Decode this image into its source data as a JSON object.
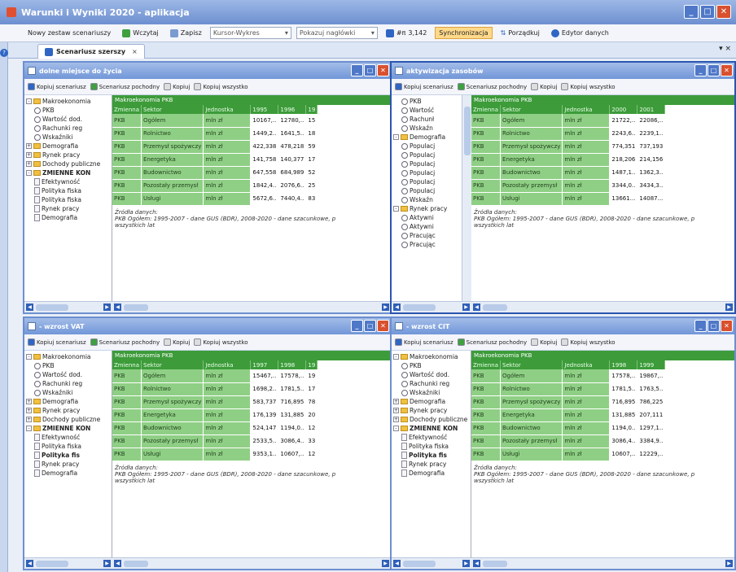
{
  "app": {
    "title": "Warunki i Wyniki 2020 - aplikacja"
  },
  "toolbar": {
    "new_scenario": "Nowy zestaw scenariuszy",
    "import": "Wczytaj",
    "save": "Zapisz",
    "combo1": "Kursor-Wykres",
    "combo2": "Pokazuj nagłówki",
    "value": "3,142",
    "sync": "Synchronizacja",
    "pozadkuj": "Porządkuj",
    "editor": "Edytor danych"
  },
  "doc_tab": {
    "label": "Scenariusz szerszy",
    "close": "×",
    "pin": "▾ ×"
  },
  "panel_tb": {
    "copy_scen": "Kopiuj scenariusz",
    "derived": "Scenariusz pochodny",
    "copy": "Kopiuj",
    "copy_all": "Kopiuj wszystko"
  },
  "grid": {
    "header": "Makroekonomia PKB",
    "cols": [
      "Zmienna",
      "Sektor",
      "Jednostka"
    ],
    "unit": "mln zł",
    "sectors": [
      "Ogółem",
      "Rolnictwo",
      "Przemysł spożywczy",
      "Energetyka",
      "Budownictwo",
      "Pozostały przemysł",
      "Usługi"
    ],
    "var": "PKB",
    "source_l1": "Źródła danych:",
    "source_l2": "PKB Ogółem: 1995-2007 - dane GUS (BDR), 2008-2020 - dane szacunkowe, p",
    "source_l3": "wszystkich lat"
  },
  "panels": [
    {
      "title": "dolne miejsce do życia",
      "years": [
        "1995",
        "1996",
        "19"
      ],
      "rows": [
        [
          "10167,..",
          "12780,..",
          "15"
        ],
        [
          "1449,2..",
          "1641,5..",
          "18"
        ],
        [
          "422,338",
          "478,218",
          "59"
        ],
        [
          "141,758",
          "140,377",
          "17"
        ],
        [
          "647,558",
          "684,989",
          "52"
        ],
        [
          "1842,4..",
          "2076,6..",
          "25"
        ],
        [
          "5672,6..",
          "7440,4..",
          "83"
        ]
      ]
    },
    {
      "title": "aktywizacja zasobów",
      "years": [
        "2000",
        "2001"
      ],
      "rows": [
        [
          "21722,..",
          "22086,.."
        ],
        [
          "2243,6..",
          "2239,1.."
        ],
        [
          "774,351",
          "737,193"
        ],
        [
          "218,206",
          "214,156"
        ],
        [
          "1487,1..",
          "1362,3.."
        ],
        [
          "3344,0..",
          "3434,3.."
        ],
        [
          "13661...",
          "14087..."
        ]
      ]
    },
    {
      "title": "- wzrost VAT",
      "years": [
        "1997",
        "1998",
        "19"
      ],
      "rows": [
        [
          "15467,..",
          "17578,..",
          "19"
        ],
        [
          "1698,2..",
          "1781,5..",
          "17"
        ],
        [
          "583,737",
          "716,895",
          "78"
        ],
        [
          "176,139",
          "131,885",
          "20"
        ],
        [
          "524,147",
          "1194,0..",
          "12"
        ],
        [
          "2533,5..",
          "3086,4..",
          "33"
        ],
        [
          "9353,1..",
          "10607,..",
          "12"
        ]
      ]
    },
    {
      "title": "- wzrost CIT",
      "years": [
        "1998",
        "1999"
      ],
      "rows": [
        [
          "17578,..",
          "19867,.."
        ],
        [
          "1781,5..",
          "1763,5.."
        ],
        [
          "716,895",
          "786,225"
        ],
        [
          "131,885",
          "207,111"
        ],
        [
          "1194,0..",
          "1297,1.."
        ],
        [
          "3086,4..",
          "3384,9.."
        ],
        [
          "10607,..",
          "12229,.."
        ]
      ]
    }
  ],
  "tree_a": [
    {
      "t": "Makroekonomia",
      "lvl": 0,
      "k": "fold",
      "e": "-"
    },
    {
      "t": "PKB",
      "lvl": 1,
      "k": "mag"
    },
    {
      "t": "Wartość dod.",
      "lvl": 1,
      "k": "mag"
    },
    {
      "t": "Rachunki reg",
      "lvl": 1,
      "k": "mag"
    },
    {
      "t": "Wskaźniki",
      "lvl": 1,
      "k": "mag"
    },
    {
      "t": "Demografia",
      "lvl": 0,
      "k": "fold",
      "e": "+"
    },
    {
      "t": "Rynek pracy",
      "lvl": 0,
      "k": "fold",
      "e": "+"
    },
    {
      "t": "Dochody publiczne",
      "lvl": 0,
      "k": "fold",
      "e": "+"
    },
    {
      "t": "ZMIENNE KON",
      "lvl": 0,
      "k": "fold",
      "e": "-",
      "b": true
    },
    {
      "t": "Efektywność",
      "lvl": 1,
      "k": "doc"
    },
    {
      "t": "Polityka fiska",
      "lvl": 1,
      "k": "doc"
    },
    {
      "t": "Polityka fiska",
      "lvl": 1,
      "k": "doc"
    },
    {
      "t": "Rynek pracy",
      "lvl": 1,
      "k": "doc"
    },
    {
      "t": "Demografia",
      "lvl": 1,
      "k": "doc"
    }
  ],
  "tree_b": [
    {
      "t": "PKB",
      "lvl": 1,
      "k": "mag"
    },
    {
      "t": "Wartość",
      "lvl": 1,
      "k": "mag"
    },
    {
      "t": "Rachunł",
      "lvl": 1,
      "k": "mag"
    },
    {
      "t": "Wskaźn",
      "lvl": 1,
      "k": "mag"
    },
    {
      "t": "Demografia",
      "lvl": 0,
      "k": "fold",
      "e": "-"
    },
    {
      "t": "Populacj",
      "lvl": 1,
      "k": "mag"
    },
    {
      "t": "Populacj",
      "lvl": 1,
      "k": "mag"
    },
    {
      "t": "Populacj",
      "lvl": 1,
      "k": "mag"
    },
    {
      "t": "Populacj",
      "lvl": 1,
      "k": "mag"
    },
    {
      "t": "Populacj",
      "lvl": 1,
      "k": "mag"
    },
    {
      "t": "Populacj",
      "lvl": 1,
      "k": "mag"
    },
    {
      "t": "Wskaźn",
      "lvl": 1,
      "k": "mag"
    },
    {
      "t": "Rynek pracy",
      "lvl": 0,
      "k": "fold",
      "e": "-"
    },
    {
      "t": "Aktywni",
      "lvl": 1,
      "k": "mag"
    },
    {
      "t": "Aktywni",
      "lvl": 1,
      "k": "mag"
    },
    {
      "t": "Pracując",
      "lvl": 1,
      "k": "mag"
    },
    {
      "t": "Pracując",
      "lvl": 1,
      "k": "mag"
    }
  ],
  "tree_c": [
    {
      "t": "Makroekonomia",
      "lvl": 0,
      "k": "fold",
      "e": "-"
    },
    {
      "t": "PKB",
      "lvl": 1,
      "k": "mag"
    },
    {
      "t": "Wartość dod.",
      "lvl": 1,
      "k": "mag"
    },
    {
      "t": "Rachunki reg",
      "lvl": 1,
      "k": "mag"
    },
    {
      "t": "Wskaźniki",
      "lvl": 1,
      "k": "mag"
    },
    {
      "t": "Demografia",
      "lvl": 0,
      "k": "fold",
      "e": "+"
    },
    {
      "t": "Rynek pracy",
      "lvl": 0,
      "k": "fold",
      "e": "+"
    },
    {
      "t": "Dochody publiczne",
      "lvl": 0,
      "k": "fold",
      "e": "+"
    },
    {
      "t": "ZMIENNE KON",
      "lvl": 0,
      "k": "fold",
      "e": "-",
      "b": true
    },
    {
      "t": "Efektywność",
      "lvl": 1,
      "k": "doc"
    },
    {
      "t": "Polityka fiska",
      "lvl": 1,
      "k": "doc"
    },
    {
      "t": "Polityka fis",
      "lvl": 1,
      "k": "doc",
      "b": true
    },
    {
      "t": "Rynek pracy",
      "lvl": 1,
      "k": "doc"
    },
    {
      "t": "Demografia",
      "lvl": 1,
      "k": "doc"
    }
  ]
}
